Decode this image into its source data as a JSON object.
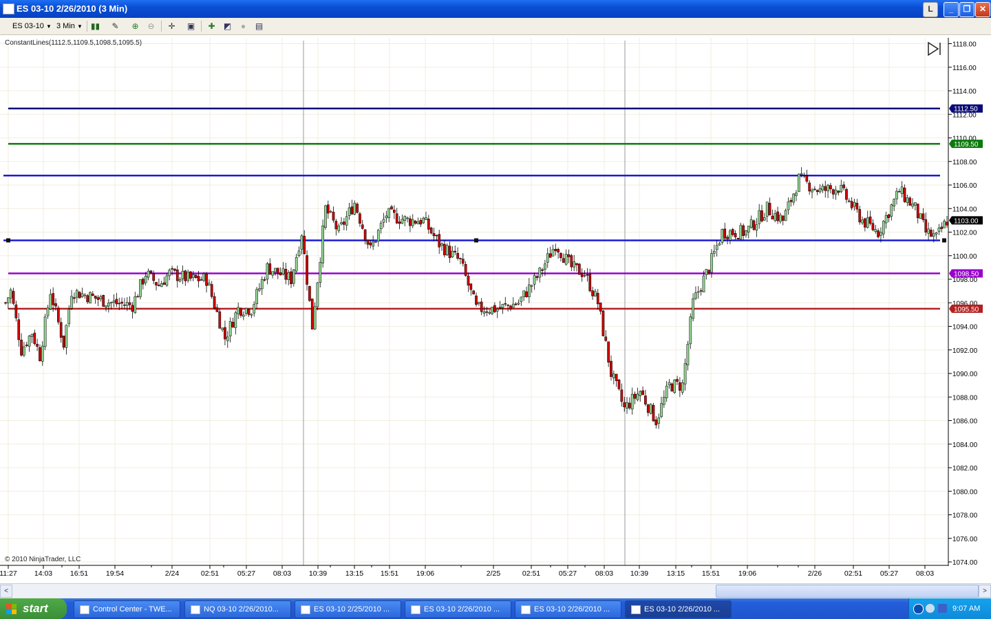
{
  "window": {
    "title": "ES 03-10  2/26/2010 (3 Min)",
    "l_button": "L",
    "minimize": "_",
    "restore": "❐",
    "close": "✕"
  },
  "toolbar": {
    "instrument": "ES 03-10",
    "period": "3 Min"
  },
  "indicator_label": "ConstantLines(1112.5,1109.5,1098.5,1095.5)",
  "copyright": "© 2010 NinjaTrader, LLC",
  "colors": {
    "up_candle": "#8fd18f",
    "down_candle": "#cc0000",
    "wick": "#000000",
    "line_1112_5": "#0b0b78",
    "line_1109_5": "#0a7a0a",
    "line_1106_8": "#1a1ad0",
    "line_1101_3": "#1a1ad0",
    "line_1098_5": "#9900cc",
    "line_1095_5": "#b32020"
  },
  "chart_data": {
    "type": "candlestick",
    "instrument": "ES 03-10",
    "interval": "3 Min",
    "ylim": [
      1074,
      1118
    ],
    "grid": true,
    "y_ticks": [
      "1118.00",
      "1116.00",
      "1114.00",
      "1112.00",
      "1110.00",
      "1108.00",
      "1106.00",
      "1104.00",
      "1102.00",
      "1100.00",
      "1098.00",
      "1096.00",
      "1094.00",
      "1092.00",
      "1090.00",
      "1088.00",
      "1086.00",
      "1084.00",
      "1082.00",
      "1080.00",
      "1078.00",
      "1076.00",
      "1074.00"
    ],
    "x_ticks": [
      "11:27",
      "14:03",
      "16:51",
      "19:54",
      "2/24",
      "02:51",
      "05:27",
      "08:03",
      "10:39",
      "13:15",
      "15:51",
      "19:06",
      "2/25",
      "02:51",
      "05:27",
      "08:03",
      "10:39",
      "13:15",
      "15:51",
      "19:06",
      "2/26",
      "02:51",
      "05:27",
      "08:03"
    ],
    "session_breaks": [
      "10:39",
      "10:39"
    ],
    "constant_lines": [
      {
        "value": 1112.5,
        "label": "1112.50"
      },
      {
        "value": 1109.5,
        "label": "1109.50"
      },
      {
        "value": 1098.5,
        "label": "1098.50"
      },
      {
        "value": 1095.5,
        "label": "1095.50"
      }
    ],
    "drawn_lines": [
      1106.8,
      1101.3
    ],
    "last_price": "1103.00",
    "price_path": [
      {
        "x": 0,
        "y": 1096.0
      },
      {
        "x": 2,
        "y": 1097.0
      },
      {
        "x": 6,
        "y": 1092.0
      },
      {
        "x": 10,
        "y": 1093.5
      },
      {
        "x": 13,
        "y": 1091.5
      },
      {
        "x": 17,
        "y": 1097.0
      },
      {
        "x": 22,
        "y": 1092.5
      },
      {
        "x": 25,
        "y": 1097.0
      },
      {
        "x": 40,
        "y": 1096.0
      },
      {
        "x": 48,
        "y": 1095.8
      },
      {
        "x": 53,
        "y": 1098.5
      },
      {
        "x": 58,
        "y": 1097.5
      },
      {
        "x": 62,
        "y": 1098.5
      },
      {
        "x": 70,
        "y": 1098.0
      },
      {
        "x": 76,
        "y": 1098.0
      },
      {
        "x": 83,
        "y": 1093.0
      },
      {
        "x": 88,
        "y": 1095.5
      },
      {
        "x": 93,
        "y": 1095.5
      },
      {
        "x": 99,
        "y": 1099.0
      },
      {
        "x": 108,
        "y": 1098.0
      },
      {
        "x": 112,
        "y": 1102.0
      },
      {
        "x": 116,
        "y": 1094.0
      },
      {
        "x": 121,
        "y": 1104.0
      },
      {
        "x": 126,
        "y": 1102.0
      },
      {
        "x": 132,
        "y": 1104.5
      },
      {
        "x": 138,
        "y": 1100.5
      },
      {
        "x": 144,
        "y": 1103.5
      },
      {
        "x": 152,
        "y": 1103.0
      },
      {
        "x": 158,
        "y": 1103.0
      },
      {
        "x": 164,
        "y": 1101.0
      },
      {
        "x": 172,
        "y": 1099.5
      },
      {
        "x": 178,
        "y": 1095.5
      },
      {
        "x": 186,
        "y": 1095.5
      },
      {
        "x": 194,
        "y": 1096.0
      },
      {
        "x": 202,
        "y": 1098.5
      },
      {
        "x": 208,
        "y": 1101.0
      },
      {
        "x": 214,
        "y": 1099.0
      },
      {
        "x": 219,
        "y": 1098.5
      },
      {
        "x": 224,
        "y": 1096.0
      },
      {
        "x": 229,
        "y": 1090.0
      },
      {
        "x": 234,
        "y": 1087.0
      },
      {
        "x": 240,
        "y": 1088.5
      },
      {
        "x": 246,
        "y": 1086.0
      },
      {
        "x": 251,
        "y": 1089.0
      },
      {
        "x": 256,
        "y": 1089.0
      },
      {
        "x": 260,
        "y": 1096.0
      },
      {
        "x": 266,
        "y": 1099.0
      },
      {
        "x": 271,
        "y": 1102.0
      },
      {
        "x": 280,
        "y": 1102.0
      },
      {
        "x": 288,
        "y": 1104.0
      },
      {
        "x": 294,
        "y": 1103.0
      },
      {
        "x": 300,
        "y": 1106.5
      },
      {
        "x": 308,
        "y": 1105.5
      },
      {
        "x": 315,
        "y": 1105.8
      },
      {
        "x": 324,
        "y": 1103.0
      },
      {
        "x": 330,
        "y": 1102.0
      },
      {
        "x": 338,
        "y": 1105.5
      },
      {
        "x": 344,
        "y": 1104.0
      },
      {
        "x": 348,
        "y": 1102.0
      },
      {
        "x": 352,
        "y": 1101.5
      },
      {
        "x": 356,
        "y": 1103.0
      }
    ]
  },
  "scrollbar": {
    "left_arrow": "<",
    "right_arrow": ">"
  },
  "taskbar": {
    "start": "start",
    "tasks": [
      {
        "label": "Control Center - TWE..."
      },
      {
        "label": "NQ 03-10  2/26/2010..."
      },
      {
        "label": "ES 03-10  2/25/2010 ..."
      },
      {
        "label": "ES 03-10  2/26/2010 ..."
      },
      {
        "label": "ES 03-10  2/26/2010 ..."
      },
      {
        "label": "ES 03-10  2/26/2010 ..."
      }
    ],
    "clock": "9:07 AM"
  }
}
